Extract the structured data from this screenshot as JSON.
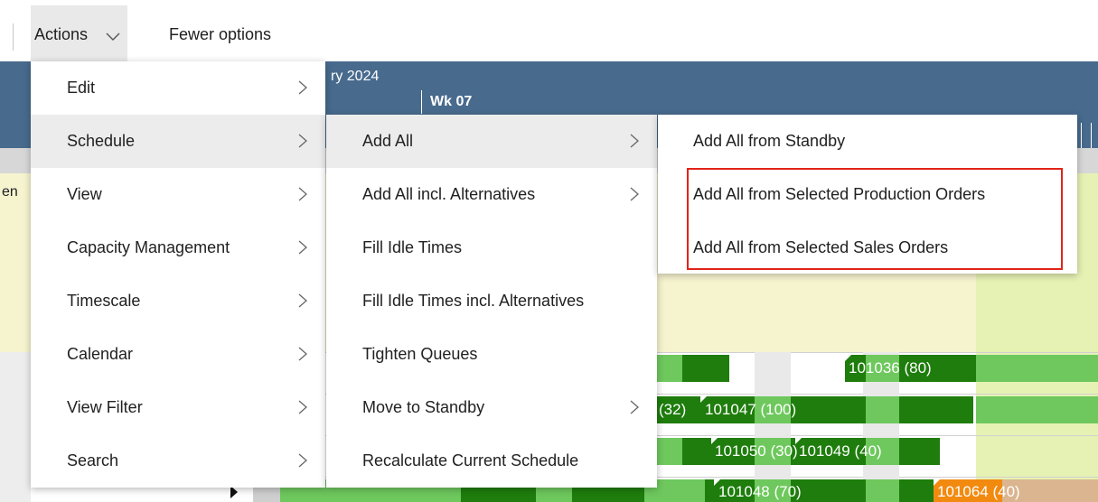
{
  "toolbar": {
    "actions_label": "Actions",
    "fewer_options_label": "Fewer options"
  },
  "gantt": {
    "month_label": "ry 2024",
    "week_label": "Wk 07",
    "row_label": "en",
    "bars": [
      {
        "label": "101036 (80)"
      },
      {
        "label": "(32)"
      },
      {
        "label": "101047 (100)"
      },
      {
        "label": "101050 (30)"
      },
      {
        "label": "101049 (40)"
      },
      {
        "label": "101048 (70)"
      },
      {
        "label": "101064 (40)"
      }
    ],
    "colors": {
      "dark_green": "#1e7d0c",
      "light_green": "#6ec85d",
      "orange": "#f28a10",
      "header": "#486a8d"
    }
  },
  "menus": {
    "actions": {
      "items": [
        {
          "label": "Edit"
        },
        {
          "label": "Schedule"
        },
        {
          "label": "View"
        },
        {
          "label": "Capacity Management"
        },
        {
          "label": "Timescale"
        },
        {
          "label": "Calendar"
        },
        {
          "label": "View Filter"
        },
        {
          "label": "Search"
        }
      ]
    },
    "schedule": {
      "items": [
        {
          "label": "Add All"
        },
        {
          "label": "Add All incl. Alternatives"
        },
        {
          "label": "Fill Idle Times"
        },
        {
          "label": "Fill Idle Times incl. Alternatives"
        },
        {
          "label": "Tighten Queues"
        },
        {
          "label": "Move to Standby"
        },
        {
          "label": "Recalculate Current Schedule"
        }
      ]
    },
    "add_all": {
      "items": [
        {
          "label": "Add All from Standby"
        },
        {
          "label": "Add All from Selected Production Orders"
        },
        {
          "label": "Add All from Selected Sales Orders"
        }
      ]
    }
  }
}
